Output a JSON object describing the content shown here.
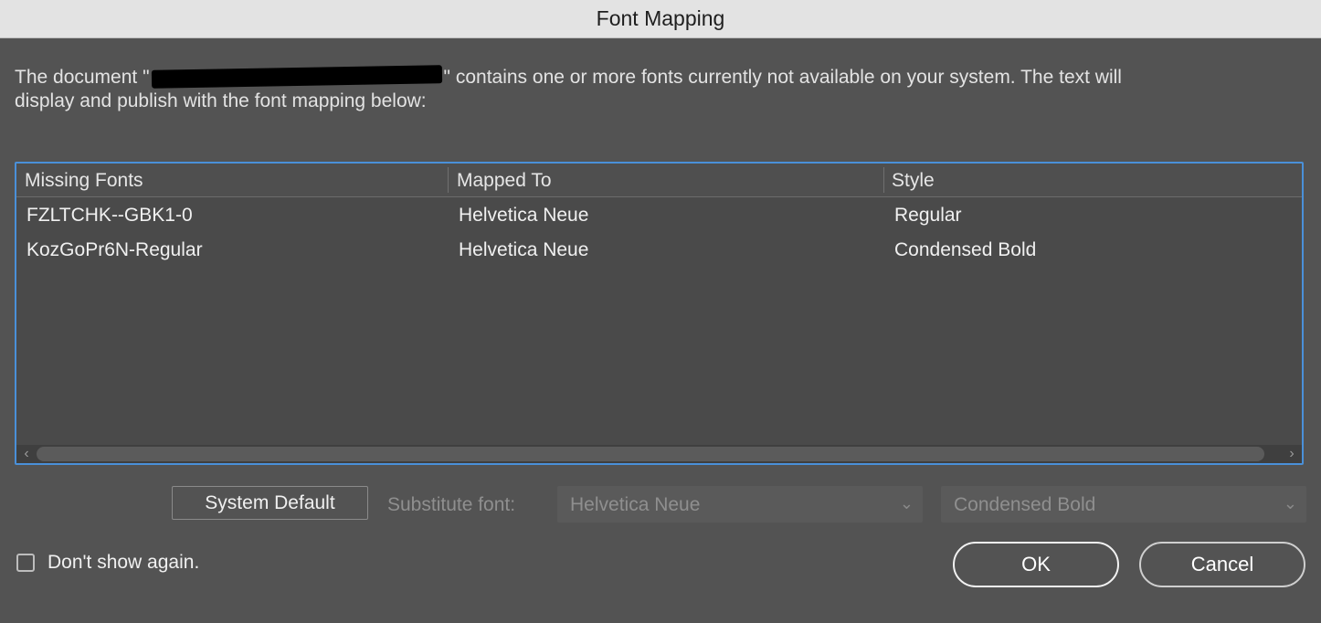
{
  "window": {
    "title": "Font Mapping"
  },
  "message": {
    "prefix": "The document \"",
    "suffix": "\" contains one or more fonts currently not available on your system. The text will",
    "line2": "display and publish with the font mapping below:"
  },
  "table": {
    "headers": [
      "Missing Fonts",
      "Mapped To",
      "Style"
    ],
    "rows": [
      {
        "missing": "FZLTCHK--GBK1-0",
        "mapped": "Helvetica Neue",
        "style": "Regular"
      },
      {
        "missing": "KozGoPr6N-Regular",
        "mapped": "Helvetica Neue",
        "style": "Condensed Bold"
      }
    ]
  },
  "controls": {
    "system_default_label": "System Default",
    "substitute_label": "Substitute font:",
    "substitute_font_value": "Helvetica Neue",
    "substitute_style_value": "Condensed Bold"
  },
  "footer": {
    "dont_show_label": "Don't show again.",
    "dont_show_checked": false,
    "ok_label": "OK",
    "cancel_label": "Cancel"
  },
  "colors": {
    "focus_ring": "#4a90d9",
    "dialog_bg": "#535353",
    "titlebar_bg": "#e3e3e3"
  }
}
